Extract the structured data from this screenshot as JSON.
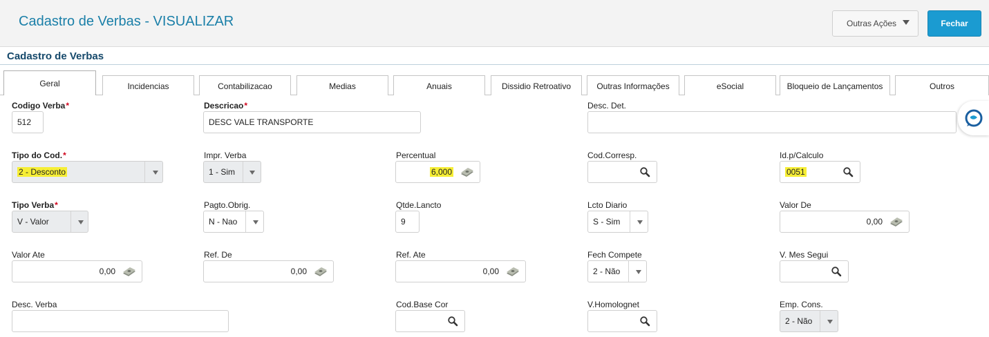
{
  "header": {
    "title": "Cadastro de Verbas - VISUALIZAR",
    "other_actions_label": "Outras Ações",
    "close_label": "Fechar"
  },
  "section": {
    "title": "Cadastro de Verbas"
  },
  "tabs": [
    "Geral",
    "Incidencias",
    "Contabilizacao",
    "Medias",
    "Anuais",
    "Dissidio Retroativo",
    "Outras Informações",
    "eSocial",
    "Bloqueio de Lançamentos",
    "Outros"
  ],
  "active_tab": "Geral",
  "fields": {
    "codigo_verba": {
      "label": "Codigo Verba",
      "value": "512"
    },
    "descricao": {
      "label": "Descricao",
      "value": "DESC VALE TRANSPORTE"
    },
    "desc_det": {
      "label": "Desc. Det.",
      "value": ""
    },
    "tipo_cod": {
      "label": "Tipo do Cod.",
      "value": "2 - Desconto"
    },
    "impr_verba": {
      "label": "Impr. Verba",
      "value": "1 - Sim"
    },
    "percentual": {
      "label": "Percentual",
      "value": "6,000"
    },
    "cod_corresp": {
      "label": "Cod.Corresp.",
      "value": ""
    },
    "id_calculo": {
      "label": "Id.p/Calculo",
      "value": "0051"
    },
    "tipo_verba": {
      "label": "Tipo Verba",
      "value": "V - Valor"
    },
    "pagto_obrig": {
      "label": "Pagto.Obrig.",
      "value": "N - Nao"
    },
    "qtde_lancto": {
      "label": "Qtde.Lancto",
      "value": "9"
    },
    "lcto_diario": {
      "label": "Lcto Diario",
      "value": "S - Sim"
    },
    "valor_de": {
      "label": "Valor De",
      "value": "0,00"
    },
    "valor_ate": {
      "label": "Valor Ate",
      "value": "0,00"
    },
    "ref_de": {
      "label": "Ref. De",
      "value": "0,00"
    },
    "ref_ate": {
      "label": "Ref. Ate",
      "value": "0,00"
    },
    "fech_compete": {
      "label": "Fech Compete",
      "value": "2 - Não"
    },
    "v_mes_segui": {
      "label": "V. Mes Segui",
      "value": ""
    },
    "desc_verba": {
      "label": "Desc. Verba",
      "value": ""
    },
    "cod_base_cor": {
      "label": "Cod.Base Cor",
      "value": ""
    },
    "v_homolognet": {
      "label": "V.Homolognet",
      "value": ""
    },
    "emp_cons": {
      "label": "Emp. Cons.",
      "value": "2 - Não"
    }
  },
  "required_marker": "*",
  "colors": {
    "title": "#1a7fa8",
    "primary_button": "#1b9bd1",
    "required": "#d0021b",
    "highlight": "#f6ee35"
  },
  "icons": [
    "chevron-down-icon",
    "search-icon",
    "money-icon",
    "chat-assistant-icon"
  ]
}
